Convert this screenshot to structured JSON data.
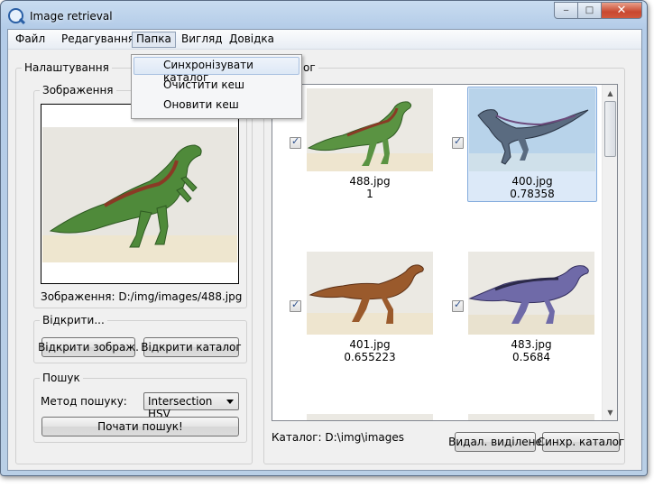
{
  "window": {
    "title": "Image retrieval",
    "caption_buttons": {
      "minimize": "‒",
      "maximize": "□",
      "close": "✕"
    }
  },
  "menu": {
    "items": [
      {
        "label": "Файл"
      },
      {
        "label": "Редагування"
      },
      {
        "label": "Папка"
      },
      {
        "label": "Вигляд"
      },
      {
        "label": "Довідка"
      }
    ],
    "dropdown": [
      {
        "label": "Синхронізувати каталог"
      },
      {
        "label": "Очистити кеш"
      },
      {
        "label": "Оновити кеш"
      }
    ]
  },
  "settings": {
    "title": "Налаштування",
    "image_group": {
      "title": "Зображення",
      "path_label": "Зображення: D:/img/images/488.jpg"
    },
    "open_group": {
      "title": "Відкрити...",
      "open_image_button": "Відкрити зображ.",
      "open_folder_button": "Відкрити каталог"
    },
    "search_group": {
      "title": "Пошук",
      "method_label": "Метод пошуку:",
      "method_value": "Intersection HSV",
      "start_button": "Почати пошук!"
    }
  },
  "results": {
    "title_fragment": "ог",
    "items": [
      {
        "name": "488.jpg",
        "score": "1",
        "checked": true,
        "selected": false
      },
      {
        "name": "400.jpg",
        "score": "0.78358",
        "checked": true,
        "selected": true
      },
      {
        "name": "401.jpg",
        "score": "0.655223",
        "checked": true,
        "selected": false
      },
      {
        "name": "483.jpg",
        "score": "0.5684",
        "checked": true,
        "selected": false
      }
    ],
    "catalog_label": "Каталог: D:\\img\\images",
    "delete_selected_button": "Видал. виділене",
    "sync_catalog_button": "Синхр. каталог"
  },
  "colors": {
    "accent": "#3c7fc1",
    "selection": "#dce9f8",
    "window_frame": "#b9cfe6",
    "close_button": "#c9482f"
  }
}
